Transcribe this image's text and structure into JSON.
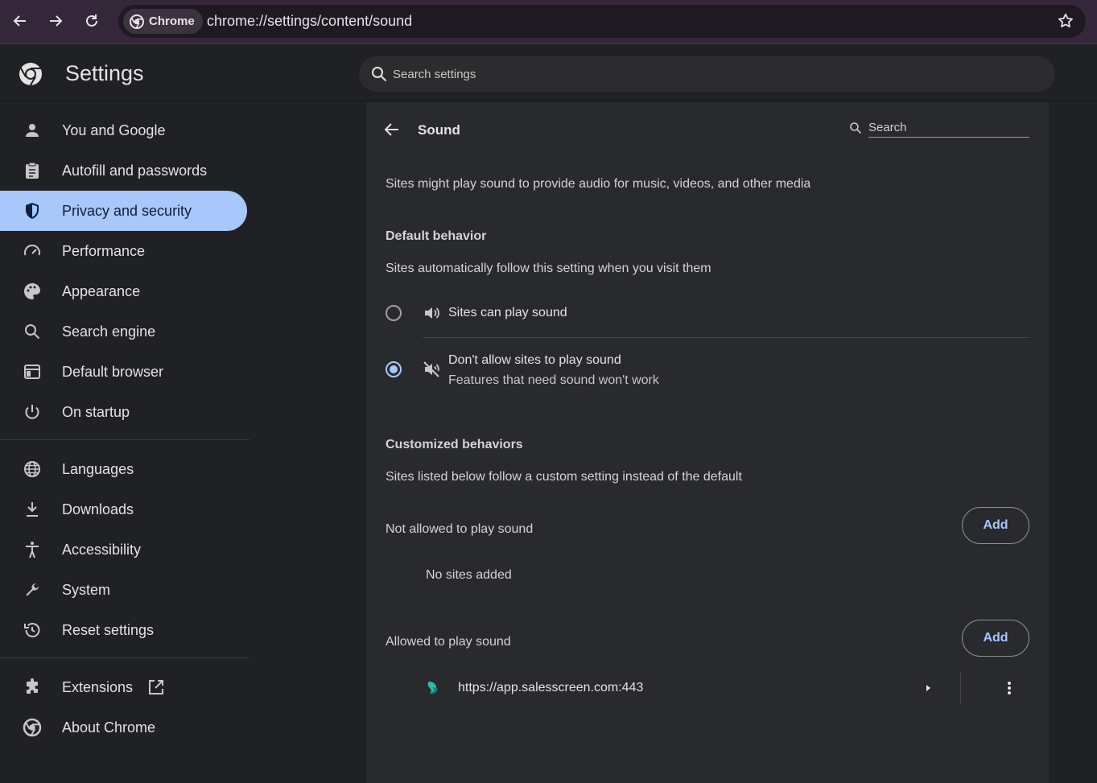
{
  "browser": {
    "chip_label": "Chrome",
    "url": "chrome://settings/content/sound"
  },
  "header": {
    "title": "Settings",
    "search_placeholder": "Search settings"
  },
  "sidebar": {
    "items": [
      {
        "label": "You and Google",
        "icon": "person-icon"
      },
      {
        "label": "Autofill and passwords",
        "icon": "clipboard-icon"
      },
      {
        "label": "Privacy and security",
        "icon": "shield-icon",
        "active": true
      },
      {
        "label": "Performance",
        "icon": "speedometer-icon"
      },
      {
        "label": "Appearance",
        "icon": "palette-icon"
      },
      {
        "label": "Search engine",
        "icon": "search-icon"
      },
      {
        "label": "Default browser",
        "icon": "browser-window-icon"
      },
      {
        "label": "On startup",
        "icon": "power-icon"
      },
      {
        "label": "Languages",
        "icon": "globe-icon"
      },
      {
        "label": "Downloads",
        "icon": "download-icon"
      },
      {
        "label": "Accessibility",
        "icon": "accessibility-icon"
      },
      {
        "label": "System",
        "icon": "wrench-icon"
      },
      {
        "label": "Reset settings",
        "icon": "history-icon"
      },
      {
        "label": "Extensions",
        "icon": "puzzle-icon"
      },
      {
        "label": "About Chrome",
        "icon": "chrome-logo-icon"
      }
    ]
  },
  "content": {
    "title": "Sound",
    "search_placeholder": "Search",
    "description": "Sites might play sound to provide audio for music, videos, and other media",
    "default_behavior": {
      "heading": "Default behavior",
      "subtext": "Sites automatically follow this setting when you visit them",
      "option_allow": "Sites can play sound",
      "option_block": "Don't allow sites to play sound",
      "option_block_sub": "Features that need sound won't work",
      "selected": "block"
    },
    "customized": {
      "heading": "Customized behaviors",
      "subtext": "Sites listed below follow a custom setting instead of the default",
      "not_allowed_label": "Not allowed to play sound",
      "not_allowed_empty": "No sites added",
      "allowed_label": "Allowed to play sound",
      "add_label": "Add",
      "allowed_sites": [
        "https://app.salesscreen.com:443"
      ]
    }
  }
}
